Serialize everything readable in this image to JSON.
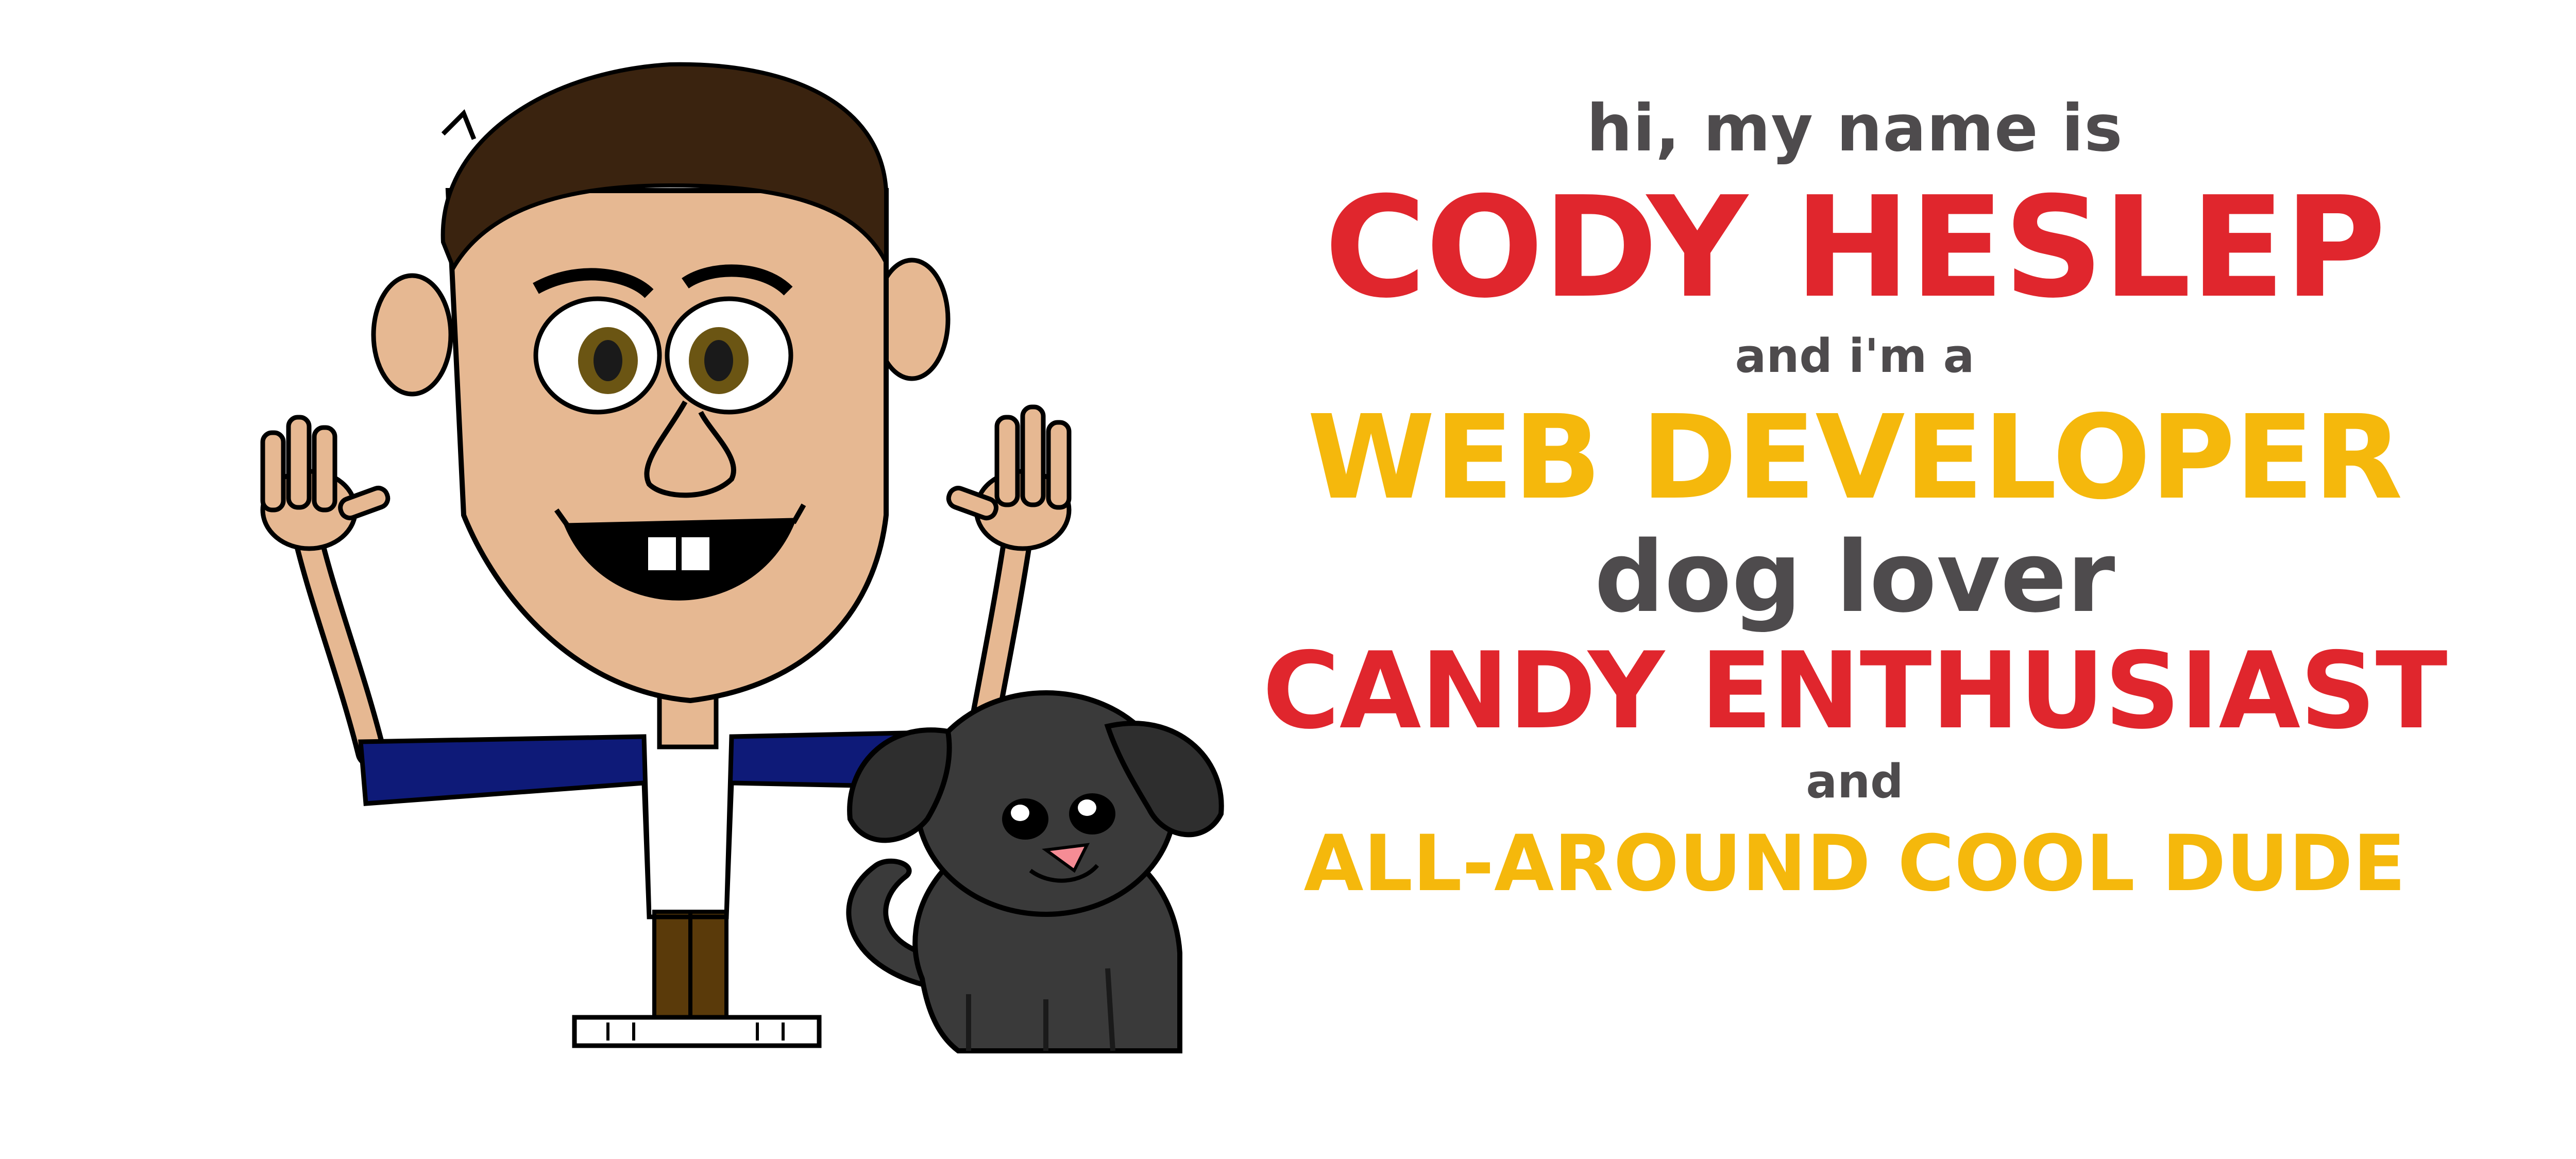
{
  "colors": {
    "red": "#E0262D",
    "yellow": "#F5B80C",
    "gray": "#4E4B4D",
    "skin": "#E6B892",
    "hair": "#3A230F",
    "shirt": "#0E1A78",
    "pants": "#5A3A0A",
    "dog": "#3A3A3A",
    "eye_iris": "#6B5513"
  },
  "intro": {
    "greeting": "hi, my name is",
    "name": "CODY HESLEP",
    "connector": "and i'm a",
    "role": "WEB DEVELOPER",
    "trait_1": "dog lover",
    "trait_2": "CANDY ENTHUSIAST",
    "connector_2": "and",
    "closing": "ALL-AROUND COOL DUDE"
  },
  "illustration": {
    "person_icon": "cartoon-person-icon",
    "dog_icon": "cartoon-dog-icon"
  }
}
